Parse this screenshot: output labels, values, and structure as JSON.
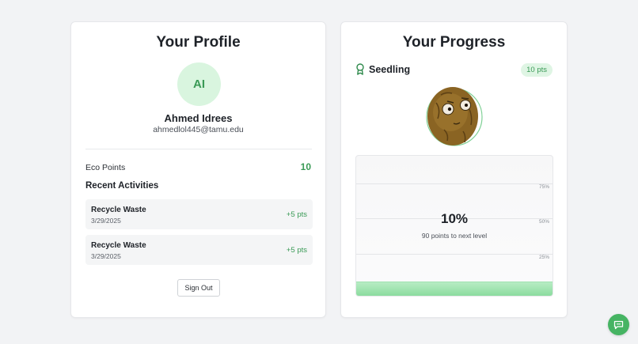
{
  "profile": {
    "title": "Your Profile",
    "avatar_initials": "AI",
    "name": "Ahmed Idrees",
    "email": "ahmedlol445@tamu.edu",
    "eco_points_label": "Eco Points",
    "eco_points_value": "10",
    "recent_heading": "Recent Activities",
    "activities": [
      {
        "title": "Recycle Waste",
        "date": "3/29/2025",
        "points": "+5 pts"
      },
      {
        "title": "Recycle Waste",
        "date": "3/29/2025",
        "points": "+5 pts"
      }
    ],
    "sign_out_label": "Sign Out"
  },
  "progress": {
    "title": "Your Progress",
    "level_icon": "award-ribbon-icon",
    "level_name": "Seedling",
    "points_badge": "10 pts",
    "mascot": "walnut-character",
    "percent_text": "10%",
    "progress_fraction": 0.1,
    "next_level_text": "90 points to next level",
    "gridlines": [
      "75%",
      "50%",
      "25%"
    ]
  },
  "chat": {
    "icon": "chat-bubble-icon"
  },
  "colors": {
    "accent": "#3a9a56",
    "accent_light": "#d9f5df",
    "background": "#f2f3f5",
    "card": "#ffffff"
  }
}
